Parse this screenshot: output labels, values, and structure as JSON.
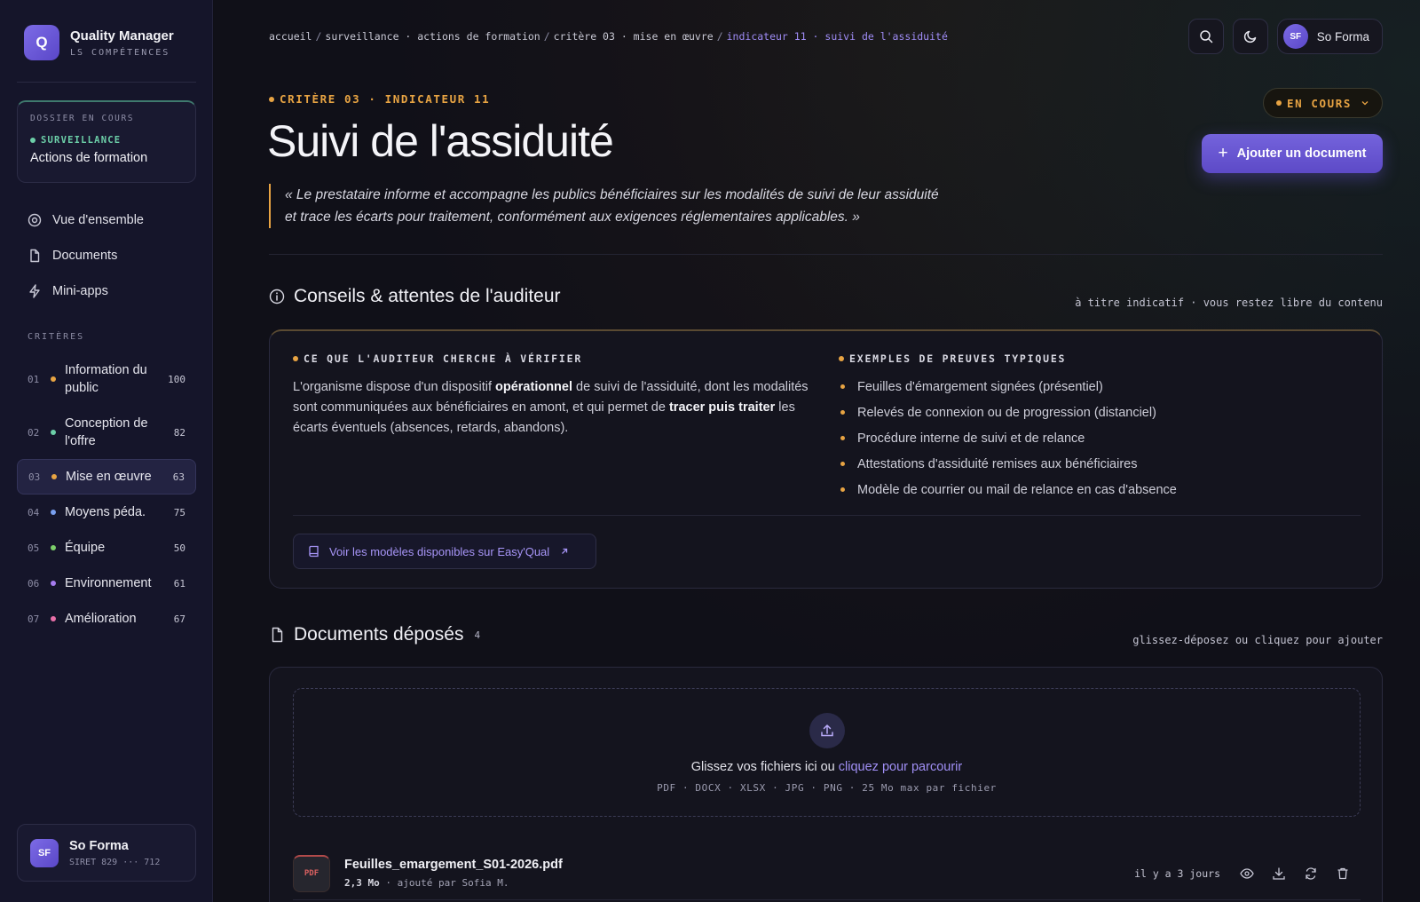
{
  "colors": {
    "accent": "#7463dc",
    "amber": "#e8a443",
    "green": "#6ccfa8",
    "link": "#a08ff5"
  },
  "brand": {
    "logo_letter": "Q",
    "title": "Quality Manager",
    "subtitle": "LS COMPÉTENCES"
  },
  "dossier": {
    "label": "DOSSIER EN COURS",
    "tag": "SURVEILLANCE",
    "name": "Actions de formation"
  },
  "nav": [
    {
      "label": "Vue d'ensemble",
      "icon": "target-icon"
    },
    {
      "label": "Documents",
      "icon": "file-icon"
    },
    {
      "label": "Mini-apps",
      "icon": "bolt-icon"
    }
  ],
  "criteria": {
    "label": "CRITÈRES",
    "items": [
      {
        "num": "01",
        "name": "Information du public",
        "score": "100",
        "color": "#e8a443"
      },
      {
        "num": "02",
        "name": "Conception de l'offre",
        "score": "82",
        "color": "#6ccfa8"
      },
      {
        "num": "03",
        "name": "Mise en œuvre",
        "score": "63",
        "color": "#e8a443"
      },
      {
        "num": "04",
        "name": "Moyens péda.",
        "score": "75",
        "color": "#7aa0f0"
      },
      {
        "num": "05",
        "name": "Équipe",
        "score": "50",
        "color": "#7ccf6a"
      },
      {
        "num": "06",
        "name": "Environnement",
        "score": "61",
        "color": "#a67cf0"
      },
      {
        "num": "07",
        "name": "Amélioration",
        "score": "67",
        "color": "#e86fa8"
      }
    ]
  },
  "user": {
    "initials": "SF",
    "name": "So Forma",
    "siret": "SIRET 829 ··· 712"
  },
  "breadcrumb": {
    "items": [
      "accueil",
      "surveillance · actions de formation",
      "critère 03 · mise en œuvre"
    ],
    "current": "indicateur 11 · suivi de l'assiduité"
  },
  "header": {
    "crit_tag": "CRITÈRE 03 · INDICATEUR 11",
    "title": "Suivi de l'assiduité",
    "status": "EN COURS",
    "add_button": "Ajouter un document",
    "quote": "« Le prestataire informe et accompagne les publics bénéficiaires sur les modalités de suivi de leur assiduité et trace les écarts pour traitement, conformément aux exigences réglementaires applicables. »"
  },
  "advice": {
    "title": "Conseils & attentes de l'auditeur",
    "note": "à titre indicatif · vous restez libre du contenu",
    "left_head": "CE QUE L'AUDITEUR CHERCHE À VÉRIFIER",
    "text_1": "L'organisme dispose d'un dispositif ",
    "text_b1": "opérationnel",
    "text_2": " de suivi de l'assiduité, dont les modalités sont communiquées aux bénéficiaires en amont, et qui permet de ",
    "text_b2": "tracer puis traiter",
    "text_3": " les écarts éventuels (absences, retards, abandons).",
    "right_head": "EXEMPLES DE PREUVES TYPIQUES",
    "proofs": [
      "Feuilles d'émargement signées (présentiel)",
      "Relevés de connexion ou de progression (distanciel)",
      "Procédure interne de suivi et de relance",
      "Attestations d'assiduité remises aux bénéficiaires",
      "Modèle de courrier ou mail de relance en cas d'absence"
    ],
    "link": "Voir les modèles disponibles sur Easy'Qual"
  },
  "docs": {
    "title": "Documents déposés",
    "count": "4",
    "note": "glissez-déposez ou cliquez pour ajouter",
    "drop_text": "Glissez vos fichiers ici ou ",
    "drop_link": "cliquez pour parcourir",
    "formats": "PDF · DOCX · XLSX · JPG · PNG · 25 Mo max par fichier",
    "files": [
      {
        "type": "PDF",
        "name": "Feuilles_emargement_S01-2026.pdf",
        "size": "2,3 Mo",
        "meta": " · ajouté par Sofia M.",
        "time": "il y a 3 jours"
      }
    ]
  }
}
